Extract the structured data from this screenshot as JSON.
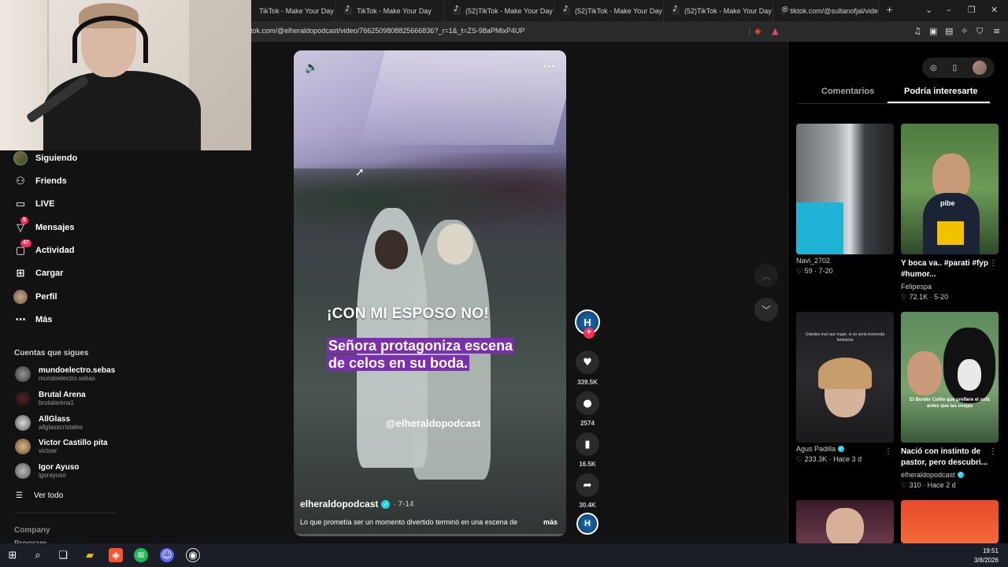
{
  "browser": {
    "tabs": [
      {
        "label": "TikTok - Make Your Day",
        "icon": "tiktok-icon"
      },
      {
        "label": "TikTok - Make Your Day",
        "icon": "tiktok-icon"
      },
      {
        "label": "(52)TikTok - Make Your Day",
        "icon": "tiktok-icon"
      },
      {
        "label": "(52)TikTok - Make Your Day",
        "icon": "tiktok-icon"
      },
      {
        "label": "(52)TikTok - Make Your Day",
        "icon": "tiktok-icon"
      },
      {
        "label": "tiktok.com/@sultanofjal/vide",
        "icon": "globe-icon"
      }
    ],
    "url": "tok.com/@elheraldopodcast/video/7662509808825666836?_r=1&_t=ZS-98aPMlxP4UP"
  },
  "sidebar": {
    "nav": [
      {
        "label": "Siguiendo",
        "icon": "avatar-icon"
      },
      {
        "label": "Friends",
        "icon": "friends-icon"
      },
      {
        "label": "LIVE",
        "icon": "live-icon"
      },
      {
        "label": "Mensajes",
        "icon": "messages-icon",
        "badge": "5"
      },
      {
        "label": "Actividad",
        "icon": "activity-icon",
        "badge": "47"
      },
      {
        "label": "Cargar",
        "icon": "upload-icon"
      },
      {
        "label": "Perfil",
        "icon": "profile-icon"
      },
      {
        "label": "Más",
        "icon": "more-icon"
      }
    ],
    "following_title": "Cuentas que sigues",
    "accounts": [
      {
        "name": "mundoelectro.sebas",
        "handle": "mundoelectro.sebas"
      },
      {
        "name": "Brutal Arena",
        "handle": "brutalarena1"
      },
      {
        "name": "AllGlass",
        "handle": "allglasscristales"
      },
      {
        "name": "Victor Castillo pita",
        "handle": "victoer"
      },
      {
        "name": "Igor Ayuso",
        "handle": "igorayuso"
      }
    ],
    "see_all": "Ver todo",
    "footer": [
      "Company",
      "Program"
    ]
  },
  "video": {
    "headline": "¡CON MI ESPOSO NO!",
    "subtitle": "Señora protagoniza escena de celos en su boda.",
    "watermark": "@elheraldopodcast",
    "author": "elheraldopodcast",
    "date": "· 7-14",
    "description": "Lo que prometía ser un momento divertido terminó en una escena de",
    "more": "más"
  },
  "actions": {
    "likes": "339.5K",
    "comments": "2574",
    "saves": "16.5K",
    "shares": "30.4K",
    "author_initial": "H"
  },
  "rightpanel": {
    "tabs": [
      "Comentarios",
      "Podría interesarte"
    ],
    "active_tab": "Podría interesarte",
    "cards": [
      {
        "title": "",
        "user": "Navi_2702",
        "likes": "59",
        "date": "7-20",
        "verified": false
      },
      {
        "title": "Y boca va.. #parati #fyp #humor...",
        "user": "Felipespa",
        "likes": "72.1K",
        "date": "5-20",
        "verified": false,
        "overlay": "pibe"
      },
      {
        "title": "",
        "user": "Agus Padilla",
        "likes": "233.3K",
        "date": "Hace 3 d",
        "verified": true,
        "overlay": "Ustedes mal naci mujer, si no sería tremenda fantasma"
      },
      {
        "title": "Nació con instinto de pastor, pero descubri...",
        "user": "elheraldopodcast",
        "likes": "310",
        "date": "Hace 2 d",
        "verified": true,
        "overlay": "El Border Collie que prefiere el sofá antes que las ovejas"
      }
    ]
  },
  "taskbar": {
    "time": "19:51",
    "date": "3/8/2026"
  }
}
